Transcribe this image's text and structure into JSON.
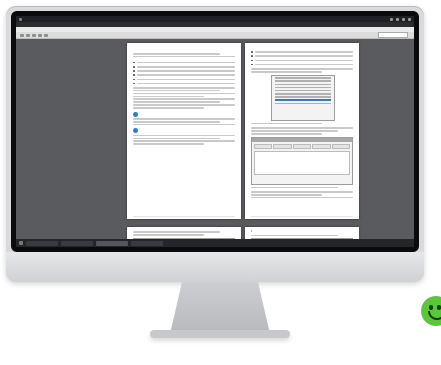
{
  "colors": {
    "heading_blue": "#1b4f8a",
    "callout_blue": "#2a7bd4",
    "smiley_green": "#5ac736",
    "monitor_silver": "#d9dadc"
  },
  "icons": {
    "callout": "info-bubble-icon",
    "smiley": "smiley-face-icon"
  },
  "topbar": {
    "app_title": ""
  },
  "window": {
    "title": ""
  },
  "menu": {
    "items": []
  },
  "toolbar": {
    "zoom_value": ""
  },
  "pages": {
    "p1": {
      "header": "",
      "title": "",
      "section": "",
      "callout_title": "",
      "subsection": ""
    },
    "p2": {
      "header": "",
      "section1": "",
      "section2": ""
    },
    "p3": {
      "item": ""
    },
    "p4": {
      "item": "1"
    }
  },
  "taskbar": {
    "tasks": [],
    "clock": ""
  }
}
